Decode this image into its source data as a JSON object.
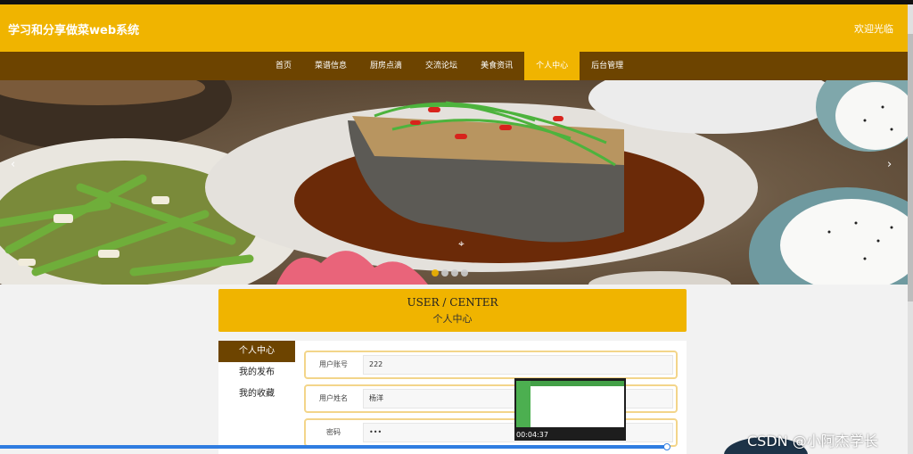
{
  "site": {
    "title": "学习和分享做菜web系统",
    "welcome": "欢迎光临"
  },
  "nav": {
    "items": [
      {
        "label": "首页"
      },
      {
        "label": "菜谱信息"
      },
      {
        "label": "厨房点滴"
      },
      {
        "label": "交流论坛"
      },
      {
        "label": "美食资讯"
      },
      {
        "label": "个人中心",
        "active": true
      },
      {
        "label": "后台管理"
      }
    ]
  },
  "banner": {
    "prev_arrow": "‹",
    "next_arrow": "›",
    "slide_count": 4,
    "active_slide": 1
  },
  "user_center": {
    "title_en": "USER / CENTER",
    "title_zh": "个人中心"
  },
  "sidebar": {
    "items": [
      {
        "label": "个人中心",
        "active": true
      },
      {
        "label": "我的发布"
      },
      {
        "label": "我的收藏"
      }
    ]
  },
  "form": {
    "fields": [
      {
        "label": "用户账号",
        "value": "222"
      },
      {
        "label": "用户姓名",
        "value": "杨洋"
      },
      {
        "label": "密码",
        "value": "•••"
      }
    ]
  },
  "video": {
    "timestamp": "00:04:37"
  },
  "watermark": "CSDN @小阿杰学长",
  "colors": {
    "accent": "#f0b400",
    "nav_bg": "#6d4400",
    "progress": "#2f7de1"
  }
}
